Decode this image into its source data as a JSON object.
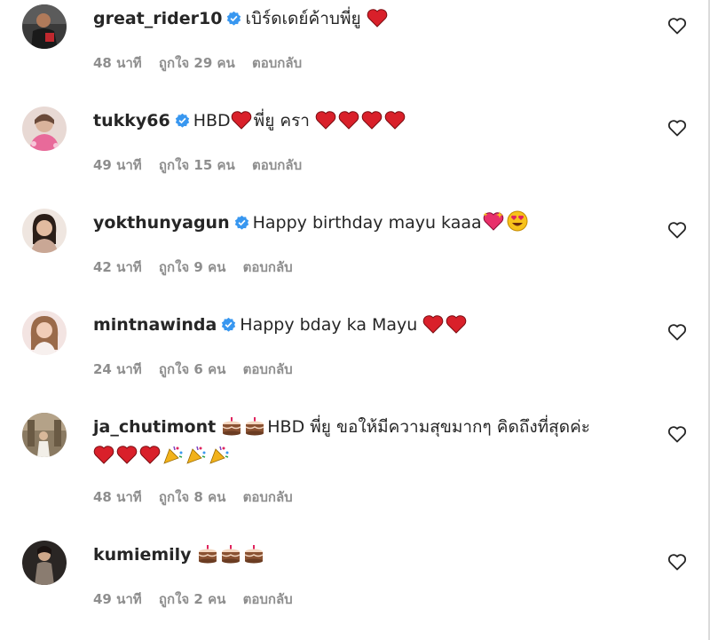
{
  "comments": [
    {
      "username": "great_rider10",
      "verified": true,
      "text": "เบิร์ดเดย์ค้าบพี่ยู",
      "emojis_after": [
        "heart-icon"
      ],
      "time": "48 นาที",
      "likes": "ถูกใจ 29 คน",
      "reply_label": "ตอบกลับ"
    },
    {
      "username": "tukky66",
      "verified": true,
      "text_parts": [
        "HBD",
        "พี่ยู ครา"
      ],
      "emojis_after": [
        "heart-icon",
        "heart-icon",
        "heart-icon",
        "heart-icon"
      ],
      "time": "49 นาที",
      "likes": "ถูกใจ 15 คน",
      "reply_label": "ตอบกลับ"
    },
    {
      "username": "yokthunyagun",
      "verified": true,
      "text": "Happy birthday mayu kaaa",
      "emojis_after": [
        "sparkling-heart-icon",
        "heart-eyes-icon"
      ],
      "time": "42 นาที",
      "likes": "ถูกใจ 9 คน",
      "reply_label": "ตอบกลับ"
    },
    {
      "username": "mintnawinda",
      "verified": true,
      "text": "Happy bday ka Mayu",
      "emojis_after": [
        "heart-icon",
        "heart-icon"
      ],
      "time": "24 นาที",
      "likes": "ถูกใจ 6 คน",
      "reply_label": "ตอบกลับ"
    },
    {
      "username": "ja_chutimont",
      "verified": false,
      "text": "HBD พี่ยู ขอให้มีความสุขมากๆ คิดถึงที่สุดค่ะ",
      "emojis_before": [
        "cake-icon",
        "cake-icon"
      ],
      "emojis_after": [
        "heart-icon",
        "heart-icon",
        "heart-icon",
        "party-popper-icon",
        "party-popper-icon",
        "party-popper-icon"
      ],
      "time": "48 นาที",
      "likes": "ถูกใจ 8 คน",
      "reply_label": "ตอบกลับ"
    },
    {
      "username": "kumiemily",
      "verified": false,
      "emojis_after": [
        "cake-icon",
        "cake-icon",
        "cake-icon"
      ],
      "time": "49 นาที",
      "likes": "ถูกใจ 2 คน",
      "reply_label": "ตอบกลับ"
    }
  ],
  "colors": {
    "text": "#262626",
    "meta": "#8e8e8e",
    "verified": "#3897f0",
    "heart": "#e0245e"
  }
}
